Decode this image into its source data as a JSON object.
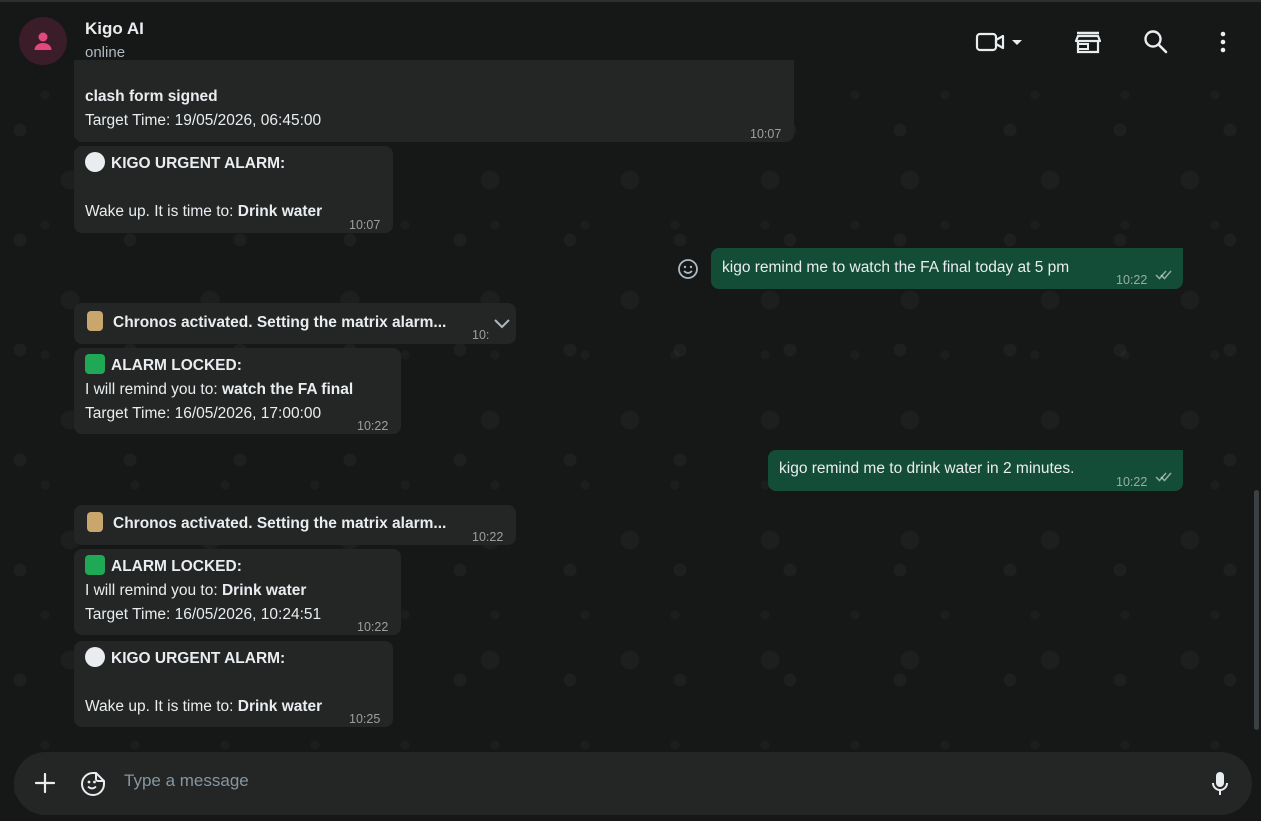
{
  "header": {
    "contact_name": "Kigo AI",
    "contact_status": "online",
    "icons": [
      "video-call-icon",
      "shop-icon",
      "search-icon",
      "more-options-icon"
    ]
  },
  "messages": [
    {
      "id": "m0",
      "direction": "in",
      "lines": [
        "clash form signed",
        "Target Time: 19/05/2026, 06:45:00"
      ],
      "time": "10:07"
    },
    {
      "id": "m1",
      "direction": "in",
      "title": "KIGO URGENT ALARM:",
      "body_prefix": "Wake up. It is time to:",
      "body_bold": "Drink water",
      "time": "10:07"
    },
    {
      "id": "m2",
      "direction": "out",
      "text": "kigo remind me to watch the FA final today at 5 pm",
      "time": "10:22"
    },
    {
      "id": "m3",
      "direction": "in",
      "text": "Chronos activated. Setting the matrix alarm...",
      "time": "10:"
    },
    {
      "id": "m4",
      "direction": "in",
      "title": "ALARM LOCKED:",
      "remind_prefix": "I will remind you to:",
      "remind_bold": "watch the FA final",
      "target": "Target Time: 16/05/2026, 17:00:00",
      "time": "10:22"
    },
    {
      "id": "m5",
      "direction": "out",
      "text": "kigo remind me to drink water in 2 minutes.",
      "time": "10:22"
    },
    {
      "id": "m6",
      "direction": "in",
      "text": "Chronos activated. Setting the matrix alarm...",
      "time": "10:22"
    },
    {
      "id": "m7",
      "direction": "in",
      "title": "ALARM LOCKED:",
      "remind_prefix": "I will remind you to:",
      "remind_bold": "Drink water",
      "target": "Target Time: 16/05/2026, 10:24:51",
      "time": "10:22"
    },
    {
      "id": "m8",
      "direction": "in",
      "title": "KIGO URGENT ALARM:",
      "body_prefix": "Wake up. It is time to:",
      "body_bold": "Drink water",
      "time": "10:25"
    }
  ],
  "composer": {
    "placeholder": "Type a message"
  },
  "colors": {
    "incoming_bubble": "#242626",
    "outgoing_bubble": "#144d37",
    "check_green": "#1fa855",
    "accent_pink": "#e4477c"
  }
}
